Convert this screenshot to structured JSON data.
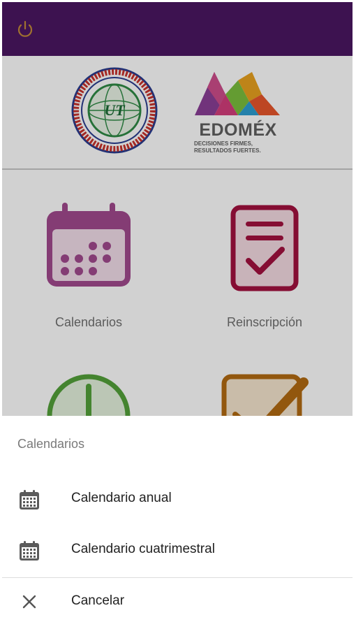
{
  "header": {
    "icon": "power-icon"
  },
  "logos": {
    "seal_text": "EXCELENCIA ACADEMICA · ESTADO DE MEXICO",
    "seal_mark": "UT",
    "edomex_word": "EDOMÉX",
    "edomex_tagline_1": "DECISIONES FIRMES,",
    "edomex_tagline_2": "RESULTADOS FUERTES."
  },
  "tiles": [
    {
      "label": "Calendarios",
      "icon": "calendar-icon",
      "color": "#a14a8e"
    },
    {
      "label": "Reinscripción",
      "icon": "checklist-icon",
      "color": "#a3103f"
    },
    {
      "label": "",
      "icon": "clock-icon",
      "color": "#54a13a"
    },
    {
      "label": "",
      "icon": "edit-check-icon",
      "color": "#b36b12"
    }
  ],
  "sheet": {
    "title": "Calendarios",
    "items": [
      {
        "label": "Calendario anual",
        "icon": "calendar-grid-icon"
      },
      {
        "label": "Calendario cuatrimestral",
        "icon": "calendar-grid-icon"
      }
    ],
    "cancel": {
      "label": "Cancelar",
      "icon": "close-icon"
    }
  },
  "colors": {
    "topbar": "#4b1762",
    "power_icon": "#c28a3a"
  }
}
